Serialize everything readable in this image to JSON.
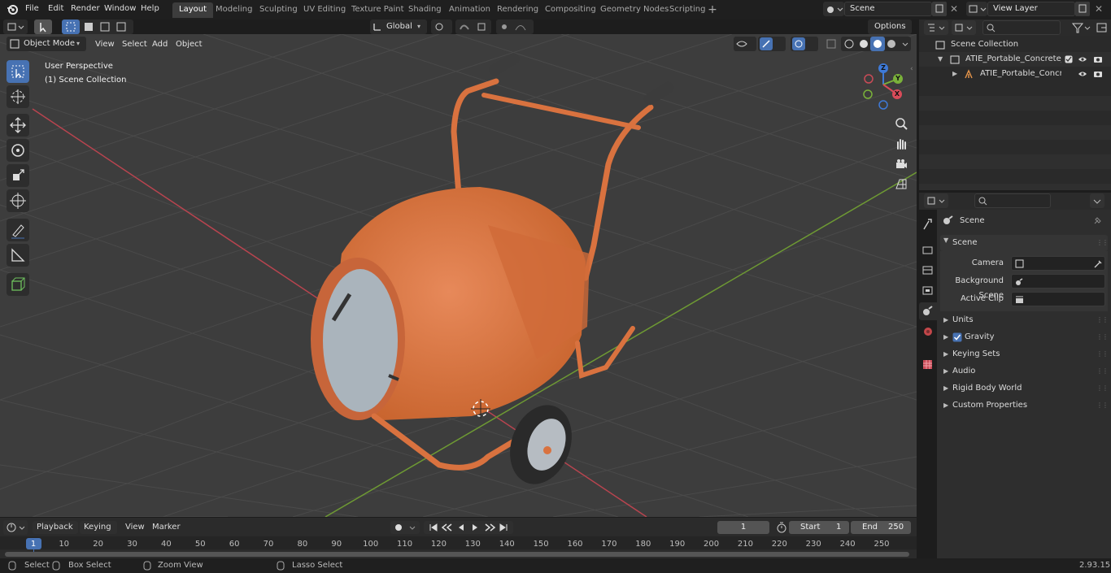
{
  "app": {
    "menus": [
      "File",
      "Edit",
      "Render",
      "Window",
      "Help"
    ],
    "workspaces": [
      "Layout",
      "Modeling",
      "Sculpting",
      "UV Editing",
      "Texture Paint",
      "Shading",
      "Animation",
      "Rendering",
      "Compositing",
      "Geometry Nodes",
      "Scripting"
    ],
    "active_workspace": "Layout",
    "scene_name": "Scene",
    "view_layer": "View Layer"
  },
  "viewport": {
    "mode": "Object Mode",
    "menus": [
      "View",
      "Select",
      "Add",
      "Object"
    ],
    "transform_orientation": "Global",
    "options_label": "Options",
    "overlay_line1": "User Perspective",
    "overlay_line2": "(1) Scene Collection",
    "gizmo": {
      "z": "Z",
      "y": "Y",
      "x": "X"
    }
  },
  "outliner": {
    "search_placeholder": "",
    "rows": [
      {
        "label": "Scene Collection"
      },
      {
        "label": "ATIE_Portable_Concrete_Mixe"
      },
      {
        "label": "ATIE_Portable_Concrete_"
      }
    ]
  },
  "properties": {
    "search_placeholder": "",
    "context": "Scene",
    "panel_title": "Scene",
    "fields": [
      {
        "label": "Camera",
        "value": ""
      },
      {
        "label": "Background Scene",
        "value": ""
      },
      {
        "label": "Active Clip",
        "value": ""
      }
    ],
    "subpanels": [
      "Units",
      "Gravity",
      "Keying Sets",
      "Audio",
      "Rigid Body World",
      "Custom Properties"
    ],
    "gravity_checked": true
  },
  "timeline": {
    "menus": [
      "Playback",
      "Keying",
      "View",
      "Marker"
    ],
    "current_frame": "1",
    "start_label": "Start",
    "start_value": "1",
    "end_label": "End",
    "end_value": "250",
    "ticks": [
      "1",
      "10",
      "20",
      "30",
      "40",
      "50",
      "60",
      "70",
      "80",
      "90",
      "100",
      "110",
      "120",
      "130",
      "140",
      "150",
      "160",
      "170",
      "180",
      "190",
      "200",
      "210",
      "220",
      "230",
      "240",
      "250"
    ]
  },
  "statusbar": {
    "items": [
      "Select",
      "Box Select",
      "Zoom View",
      "Lasso Select"
    ],
    "version": "2.93.15"
  },
  "colors": {
    "accent": "#4772b3",
    "mixer_orange": "#d9723f",
    "x_axis": "#b8444f",
    "y_axis": "#6e9a33"
  }
}
